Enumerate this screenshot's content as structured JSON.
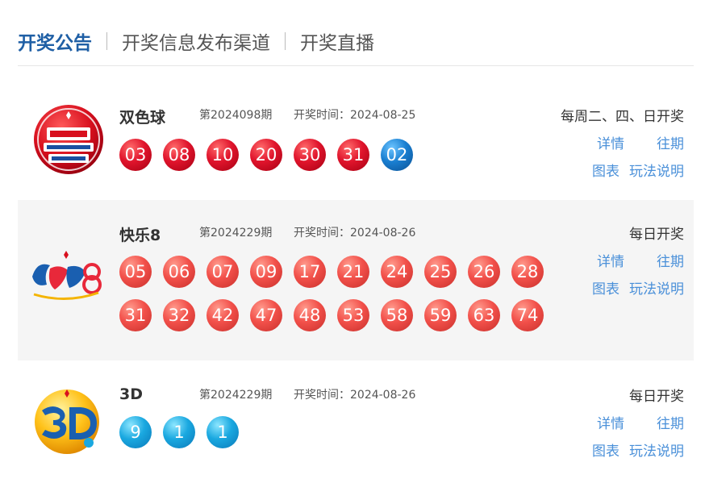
{
  "tabs": [
    {
      "label": "开奖公告",
      "active": true
    },
    {
      "label": "开奖信息发布渠道",
      "active": false
    },
    {
      "label": "开奖直播",
      "active": false
    }
  ],
  "colors": {
    "accent": "#1f5fa5",
    "link": "#4a90d9",
    "red_ball": "#e0142c",
    "blue_ball": "#1a7fd1",
    "coral_ball": "#f2504a",
    "cyan_ball": "#1aa8e0"
  },
  "lotteries": [
    {
      "name": "双色球",
      "logo_icon": "double-color-ball-logo",
      "issue": "第2024098期",
      "draw_time": "开奖时间：2024-08-25",
      "schedule": "每周二、四、日开奖",
      "red_balls": [
        "03",
        "08",
        "10",
        "20",
        "30",
        "31"
      ],
      "blue_balls": [
        "02"
      ],
      "links": {
        "detail": "详情",
        "history": "往期",
        "chart": "图表",
        "rules": "玩法说明"
      }
    },
    {
      "name": "快乐8",
      "logo_icon": "happy8-logo",
      "issue": "第2024229期",
      "draw_time": "开奖时间：2024-08-26",
      "schedule": "每日开奖",
      "balls_row1": [
        "05",
        "06",
        "07",
        "09",
        "17",
        "21",
        "24",
        "25",
        "26",
        "28"
      ],
      "balls_row2": [
        "31",
        "32",
        "42",
        "47",
        "48",
        "53",
        "58",
        "59",
        "63",
        "74"
      ],
      "links": {
        "detail": "详情",
        "history": "往期",
        "chart": "图表",
        "rules": "玩法说明"
      }
    },
    {
      "name": "3D",
      "logo_icon": "3d-logo",
      "issue": "第2024229期",
      "draw_time": "开奖时间：2024-08-26",
      "schedule": "每日开奖",
      "balls": [
        "9",
        "1",
        "1"
      ],
      "links": {
        "detail": "详情",
        "history": "往期",
        "chart": "图表",
        "rules": "玩法说明"
      }
    }
  ]
}
